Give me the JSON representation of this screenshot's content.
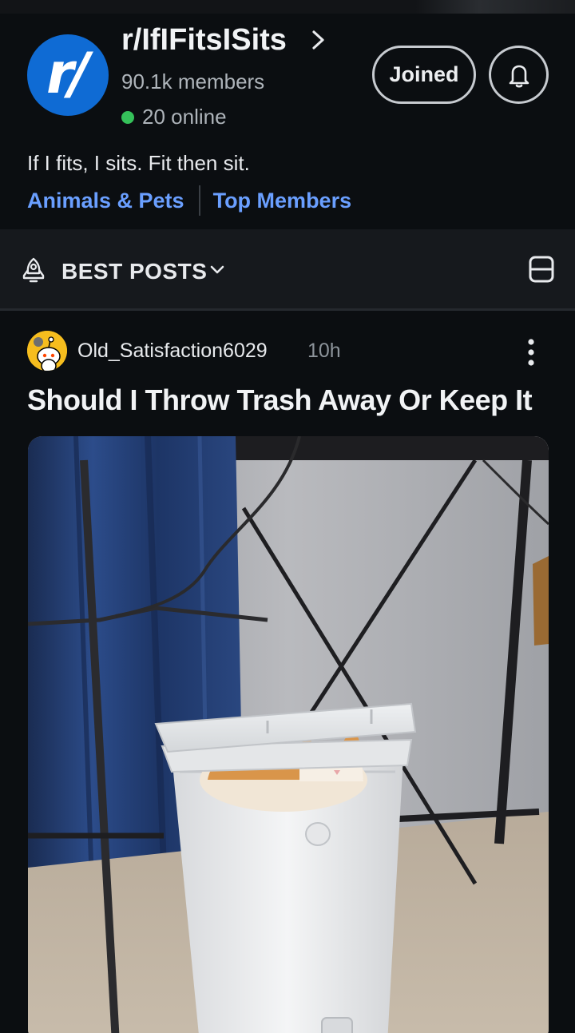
{
  "community": {
    "name": "r/IfIFitsISits",
    "avatar_text": "r/",
    "members": "90.1k members",
    "online": "20 online",
    "join_label": "Joined",
    "description": "If I fits, I sits. Fit then sit.",
    "links": [
      "Animals & Pets",
      "Top Members"
    ],
    "colors": {
      "avatar": "#0f6bd4",
      "link": "#6a9fff",
      "online": "#35c15a"
    }
  },
  "sort": {
    "label": "BEST POSTS"
  },
  "post": {
    "author": "Old_Satisfaction6029",
    "time": "10h",
    "title": "Should I Throw Trash Away Or Keep It"
  },
  "icons": [
    "chevron-right-icon",
    "bell-icon",
    "rocket-icon",
    "chevron-down-icon",
    "card-view-icon",
    "kebab-menu-icon"
  ]
}
